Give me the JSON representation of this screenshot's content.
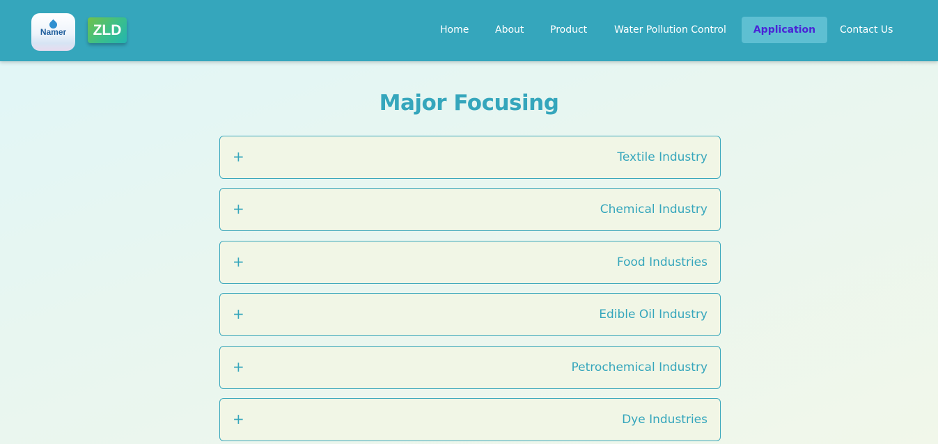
{
  "header": {
    "logo_namer_text": "Namer",
    "logo_zld_text": "ZLD",
    "nav": [
      {
        "label": "Home",
        "active": false
      },
      {
        "label": "About",
        "active": false
      },
      {
        "label": "Product",
        "active": false
      },
      {
        "label": "Water Pollution Control",
        "active": false
      },
      {
        "label": "Application",
        "active": true
      },
      {
        "label": "Contact Us",
        "active": false
      }
    ]
  },
  "main": {
    "title": "Major Focusing",
    "accordion": [
      {
        "icon": "+",
        "label": "Textile Industry"
      },
      {
        "icon": "+",
        "label": "Chemical Industry"
      },
      {
        "icon": "+",
        "label": "Food Industries"
      },
      {
        "icon": "+",
        "label": "Edible Oil Industry"
      },
      {
        "icon": "+",
        "label": "Petrochemical Industry"
      },
      {
        "icon": "+",
        "label": "Dye Industries"
      }
    ]
  },
  "colors": {
    "nav_background": "#35a6bc",
    "accent": "#35a6bc",
    "active_nav_text": "#4a25d6",
    "active_nav_background": "#5ebfd2",
    "accordion_background": "#f1f6e6"
  },
  "icons": {
    "namer_logo": "water-drop-logo",
    "accordion_toggle": "plus-icon"
  }
}
